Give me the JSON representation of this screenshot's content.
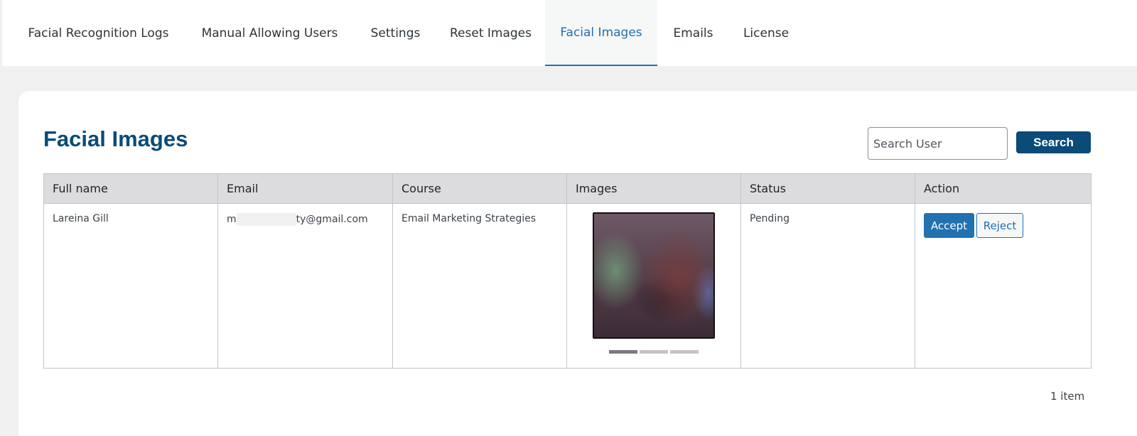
{
  "nav": {
    "tabs": [
      {
        "label": "Facial Recognition Logs"
      },
      {
        "label": "Manual Allowing Users"
      },
      {
        "label": "Settings"
      },
      {
        "label": "Reset Images"
      },
      {
        "label": "Facial Images",
        "active": true
      },
      {
        "label": "Emails"
      },
      {
        "label": "License"
      }
    ]
  },
  "page": {
    "title": "Facial Images"
  },
  "search": {
    "placeholder": "Search User",
    "button_label": "Search"
  },
  "table": {
    "headers": [
      "Full name",
      "Email",
      "Course",
      "Images",
      "Status",
      "Action"
    ],
    "rows": [
      {
        "full_name": "Lareina Gill",
        "email_start": "m",
        "email_end": "ty@gmail.com",
        "course": "Email Marketing Strategies",
        "image_count": 3,
        "active_image": 1,
        "status": "Pending",
        "accept_label": "Accept",
        "reject_label": "Reject"
      }
    ]
  },
  "footer": {
    "count_text": "1 item"
  },
  "colors": {
    "accent": "#2271b1",
    "title": "#0a4b78",
    "header_bg": "#dcdcde"
  }
}
